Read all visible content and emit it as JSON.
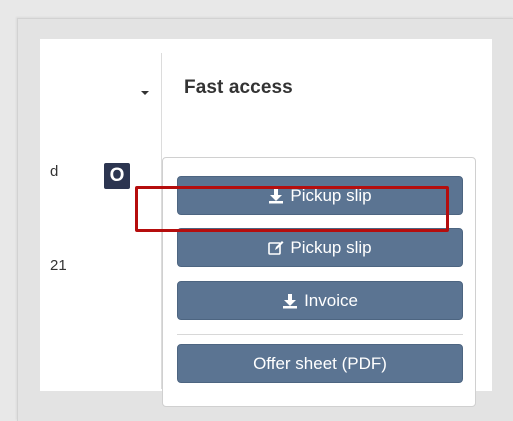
{
  "header": {
    "fast_access_label": "Fast access"
  },
  "row": {
    "partial_text_top": "d",
    "partial_text_bottom": "21",
    "status_letter": "O"
  },
  "fast_access": {
    "buttons": [
      {
        "label": "Pickup slip",
        "icon": "download-icon"
      },
      {
        "label": "Pickup slip",
        "icon": "edit-icon"
      },
      {
        "label": "Invoice",
        "icon": "download-icon"
      },
      {
        "label": "Offer sheet (PDF)",
        "icon": ""
      }
    ]
  },
  "colors": {
    "button_bg": "#5b7492",
    "status_bg": "#2c3550",
    "highlight": "#b50d0d"
  }
}
